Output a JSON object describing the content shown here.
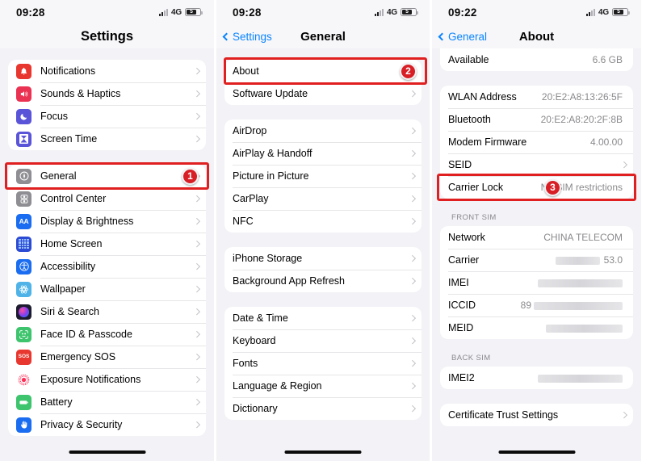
{
  "screen1": {
    "status": {
      "time": "09:28",
      "network": "4G",
      "battery": "5"
    },
    "nav": {
      "title": "Settings"
    },
    "groups": [
      {
        "items": [
          {
            "label": "Notifications",
            "icon": "bell-icon",
            "color": "#e8372f",
            "chevron": true
          },
          {
            "label": "Sounds & Haptics",
            "icon": "speaker-icon",
            "color": "#ea3352",
            "chevron": true
          },
          {
            "label": "Focus",
            "icon": "moon-icon",
            "color": "#5a54d8",
            "chevron": true
          },
          {
            "label": "Screen Time",
            "icon": "hourglass-icon",
            "color": "#5a54d8",
            "chevron": true
          }
        ]
      },
      {
        "items": [
          {
            "label": "General",
            "icon": "gear-icon",
            "color": "#8e8e93",
            "chevron": true,
            "highlighted": true,
            "badge": "1"
          },
          {
            "label": "Control Center",
            "icon": "sliders-icon",
            "color": "#8e8e93",
            "chevron": true
          },
          {
            "label": "Display & Brightness",
            "icon": "aa-icon",
            "color": "#1a6cf0",
            "chevron": true
          },
          {
            "label": "Home Screen",
            "icon": "grid-icon",
            "color": "#2c4bd4",
            "chevron": true
          },
          {
            "label": "Accessibility",
            "icon": "accessibility-icon",
            "color": "#1a6cf0",
            "chevron": true
          },
          {
            "label": "Wallpaper",
            "icon": "wallpaper-icon",
            "color": "#4fb3e8",
            "chevron": true
          },
          {
            "label": "Siri & Search",
            "icon": "siri-icon",
            "color": "#1c1c2e",
            "chevron": true
          },
          {
            "label": "Face ID & Passcode",
            "icon": "faceid-icon",
            "color": "#3ec46d",
            "chevron": true
          },
          {
            "label": "Emergency SOS",
            "icon": "sos-icon",
            "color": "#e8372f",
            "chevron": true
          },
          {
            "label": "Exposure Notifications",
            "icon": "exposure-icon",
            "color": "#ffffff",
            "chevron": true
          },
          {
            "label": "Battery",
            "icon": "battery-icon",
            "color": "#3ec46d",
            "chevron": true
          },
          {
            "label": "Privacy & Security",
            "icon": "hand-icon",
            "color": "#1a6cf0",
            "chevron": true
          }
        ]
      }
    ]
  },
  "screen2": {
    "status": {
      "time": "09:28",
      "network": "4G",
      "battery": "5"
    },
    "nav": {
      "back": "Settings",
      "title": "General"
    },
    "groups": [
      {
        "items": [
          {
            "label": "About",
            "chevron": false,
            "highlighted": true,
            "badge": "2"
          },
          {
            "label": "Software Update",
            "chevron": true
          }
        ]
      },
      {
        "items": [
          {
            "label": "AirDrop",
            "chevron": true
          },
          {
            "label": "AirPlay & Handoff",
            "chevron": true
          },
          {
            "label": "Picture in Picture",
            "chevron": true
          },
          {
            "label": "CarPlay",
            "chevron": true
          },
          {
            "label": "NFC",
            "chevron": true
          }
        ]
      },
      {
        "items": [
          {
            "label": "iPhone Storage",
            "chevron": true
          },
          {
            "label": "Background App Refresh",
            "chevron": true
          }
        ]
      },
      {
        "items": [
          {
            "label": "Date & Time",
            "chevron": true
          },
          {
            "label": "Keyboard",
            "chevron": true
          },
          {
            "label": "Fonts",
            "chevron": true
          },
          {
            "label": "Language & Region",
            "chevron": true
          },
          {
            "label": "Dictionary",
            "chevron": true
          }
        ]
      }
    ]
  },
  "screen3": {
    "status": {
      "time": "09:22",
      "network": "4G",
      "battery": "5"
    },
    "nav": {
      "back": "General",
      "title": "About"
    },
    "groups": [
      {
        "clipped": true,
        "items": [
          {
            "label": "Available",
            "value": "6.6 GB",
            "chevron": false
          }
        ]
      },
      {
        "items": [
          {
            "label": "WLAN Address",
            "value": "20:E2:A8:13:26:5F",
            "chevron": false
          },
          {
            "label": "Bluetooth",
            "value": "20:E2:A8:20:2F:8B",
            "chevron": false
          },
          {
            "label": "Modem Firmware",
            "value": "4.00.00",
            "chevron": false
          },
          {
            "label": "SEID",
            "value": "",
            "chevron": true
          },
          {
            "label": "Carrier Lock",
            "value": "No SIM restrictions",
            "chevron": false,
            "highlighted": true,
            "badge": "3"
          }
        ]
      },
      {
        "header": "FRONT SIM",
        "items": [
          {
            "label": "Network",
            "value": "CHINA TELECOM",
            "chevron": false
          },
          {
            "label": "Carrier",
            "value": "53.0",
            "redacted": 55,
            "chevron": false
          },
          {
            "label": "IMEI",
            "value": "",
            "redacted": 105,
            "chevron": false
          },
          {
            "label": "ICCID",
            "value": "89",
            "redacted": 110,
            "chevron": false
          },
          {
            "label": "MEID",
            "value": "",
            "redacted": 95,
            "chevron": false
          }
        ]
      },
      {
        "header": "BACK SIM",
        "items": [
          {
            "label": "IMEI2",
            "value": "",
            "redacted": 105,
            "chevron": false
          }
        ]
      },
      {
        "items": [
          {
            "label": "Certificate Trust Settings",
            "chevron": true
          }
        ]
      }
    ]
  }
}
